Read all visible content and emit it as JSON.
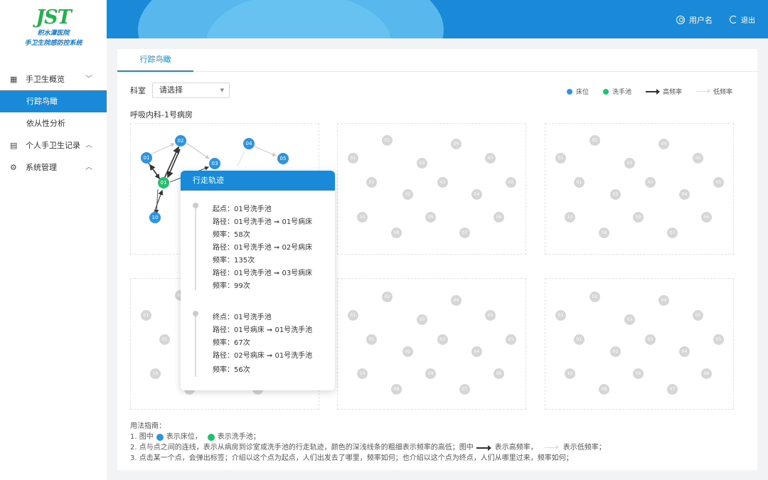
{
  "brand": {
    "logo_text": "JST",
    "hospital": "积水潭医院",
    "system": "手卫生院感防控系统"
  },
  "sidebar": {
    "groups": [
      {
        "label": "手卫生概览",
        "icon": "overview-icon",
        "chevron": "chevron-down-icon"
      },
      {
        "label": "个人手卫生记录",
        "icon": "record-icon",
        "chevron": "chevron-up-icon"
      },
      {
        "label": "系统管理",
        "icon": "gear-icon",
        "chevron": "chevron-up-icon"
      }
    ],
    "sub_items": [
      {
        "label": "行踪鸟瞰",
        "active": true
      },
      {
        "label": "依从性分析",
        "active": false
      }
    ]
  },
  "header": {
    "username": "用户名",
    "logout": "退出",
    "accent_color": "#1a8ad8"
  },
  "tabs": [
    {
      "label": "行踪鸟瞰"
    }
  ],
  "filter": {
    "label": "科室",
    "select_value": "请选择"
  },
  "legend": {
    "bed": "床位",
    "sink": "洗手池",
    "high": "高频率",
    "low": "低频率",
    "bed_color": "#2f94dc",
    "sink_color": "#20c36d"
  },
  "ward_title": "呼吸内科-1号病房",
  "panel1_nodes": {
    "n01": "01",
    "n02": "02",
    "n03": "03",
    "n04": "04",
    "n05": "05",
    "n10": "10",
    "sink": "01"
  },
  "grid_node_labels": [
    "01",
    "02",
    "03",
    "04",
    "05",
    "06",
    "07",
    "08",
    "09",
    "10"
  ],
  "popup": {
    "title": "行走轨迹",
    "start": {
      "label": "起点：01号洗手池",
      "routes": [
        {
          "path": "路径：01号洗手池 ➞ 01号病床",
          "freq": "频率：58次"
        },
        {
          "path": "路径：01号洗手池 ➞ 02号病床",
          "freq": "频率：135次"
        },
        {
          "path": "路径：01号洗手池 ➞ 03号病床",
          "freq": "频率：99次"
        }
      ]
    },
    "end": {
      "label": "终点：01号洗手池",
      "routes": [
        {
          "path": "路径：01号病床 ➞ 01号洗手池",
          "freq": "频率：67次"
        },
        {
          "path": "路径：02号病床 ➞ 01号洗手池",
          "freq": "频率：56次"
        }
      ]
    }
  },
  "guide": {
    "title": "用法指南：",
    "line1_a": "1. 图中",
    "line1_b": "表示床位，",
    "line1_c": "表示洗手池；",
    "line2_a": "2. 点与点之间的连线，表示从病房到诊室或洗手池的行走轨迹，颜色的深浅线条的粗细表示频率的高低；图中",
    "line2_b": "表示高频率，",
    "line2_c": "表示低频率；",
    "line3": "3. 点击某一个点，会弹出标签；介绍以这个点为起点，人们出发去了哪里，频率如何；也介绍以这个点为终点，人们从哪里过来，频率如何；"
  }
}
